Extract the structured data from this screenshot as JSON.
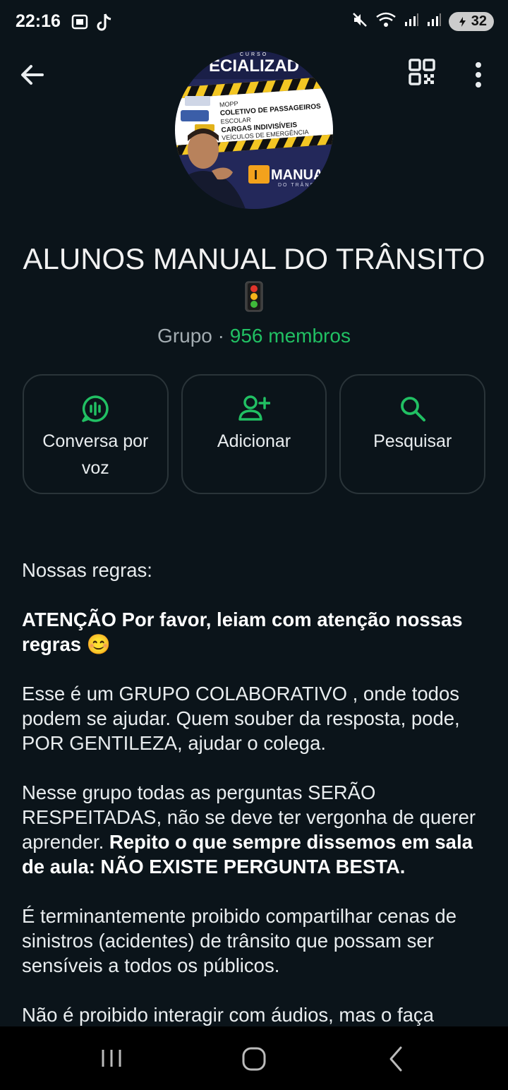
{
  "status_bar": {
    "time": "22:16",
    "battery": "32",
    "icons": [
      "screenshot-icon",
      "tiktok-icon",
      "mute-icon",
      "wifi-icon",
      "signal-icon",
      "signal-icon",
      "battery-icon"
    ]
  },
  "header": {
    "back_icon": "back-arrow-icon",
    "qr_icon": "qr-code-icon",
    "more_icon": "more-vertical-icon"
  },
  "avatar": {
    "banner_text": "ECIALIZAD",
    "small_text": "CURSO",
    "list": [
      "MOPP",
      "COLETIVO DE PASSAGEIROS",
      "ESCOLAR",
      "CARGAS INDIVISÍVEIS",
      "VEÍCULOS DE EMERGÊNCIA"
    ],
    "brand": "MANUAL",
    "brand_sub": "DO TRÂNS"
  },
  "group": {
    "title": "ALUNOS MANUAL DO TRÂNSITO",
    "title_emoji": "traffic-light-icon",
    "type": "Grupo",
    "separator": " · ",
    "members": "956 membros"
  },
  "actions": [
    {
      "label_line1": "Conversa por",
      "label_line2": "voz",
      "icon": "voice-chat-icon"
    },
    {
      "label": "Adicionar",
      "icon": "add-person-icon"
    },
    {
      "label": "Pesquisar",
      "icon": "search-icon"
    }
  ],
  "description": {
    "rules_heading": "Nossas regras:",
    "attention_bold": "ATENÇÃO Por favor, leiam com atenção nossas regras",
    "attention_emoji": "😊",
    "p1": "Esse é um GRUPO COLABORATIVO , onde todos podem se ajudar. Quem souber da resposta, pode, POR GENTILEZA, ajudar o colega.",
    "p2_normal": "Nesse grupo todas as perguntas SERÃO RESPEITADAS, não se deve ter vergonha de querer aprender. ",
    "p2_bold": "Repito o que sempre dissemos em sala de aula: NÃO EXISTE PERGUNTA BESTA.",
    "p3": "É terminantemente proibido compartilhar cenas de sinistros (acidentes) de trânsito que possam ser sensíveis a todos os públicos.",
    "p4": "Não é proibido interagir com áudios, mas o faça"
  },
  "colors": {
    "background": "#0b141a",
    "accent": "#21c063",
    "text": "#e9edef",
    "muted": "#a3acb1"
  },
  "nav": {
    "recent_icon": "recent-apps-icon",
    "home_icon": "home-icon",
    "back_icon": "nav-back-icon"
  }
}
